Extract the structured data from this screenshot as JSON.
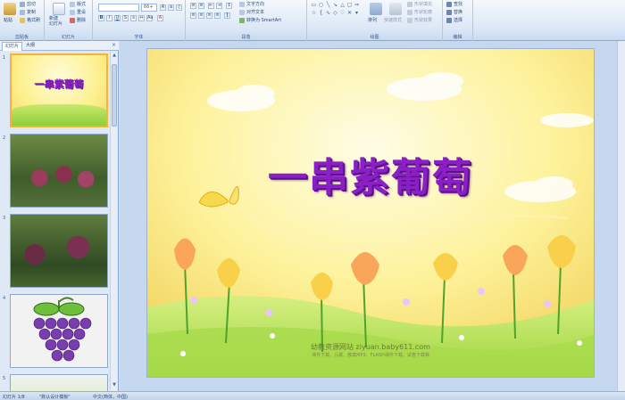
{
  "ribbon": {
    "clipboard": {
      "paste": "粘贴",
      "cut": "剪切",
      "copy": "复制",
      "format_painter": "格式刷",
      "label": "剪贴板"
    },
    "slides": {
      "new_slide": "新建\n幻灯片",
      "layout": "版式",
      "reset": "重设",
      "delete": "删除",
      "label": "幻灯片"
    },
    "font": {
      "font_name": "",
      "font_size": "66+",
      "label": "字体"
    },
    "paragraph": {
      "text_direction": "文字方向",
      "align_text": "对齐文本",
      "smartart": "转换为 SmartArt",
      "label": "段落"
    },
    "drawing": {
      "arrange": "排列",
      "quick_styles": "快速样式",
      "shape_fill": "形状填充",
      "shape_outline": "形状轮廓",
      "shape_effects": "形状效果",
      "label": "绘图"
    },
    "editing": {
      "find": "查找",
      "replace": "替换",
      "select": "选择",
      "label": "编辑"
    }
  },
  "left_pane": {
    "tab_slides": "幻灯片",
    "tab_outline": "大纲",
    "thumbs": [
      {
        "num": "1",
        "title": "一串紫葡萄"
      },
      {
        "num": "2"
      },
      {
        "num": "3"
      },
      {
        "num": "4"
      },
      {
        "num": "5"
      }
    ]
  },
  "slide": {
    "title": "一串紫葡萄",
    "site_line": "幼教资源网站 ziyuan.baby611.com",
    "sub_line": "课件下载、儿歌、教案MP3、FLASH课件下载、试卷下载等"
  },
  "status_bar": {
    "slide_pos": "幻灯片 1/8",
    "theme": "\"默认设计模板\"",
    "language": "中文(简体，中国)"
  }
}
